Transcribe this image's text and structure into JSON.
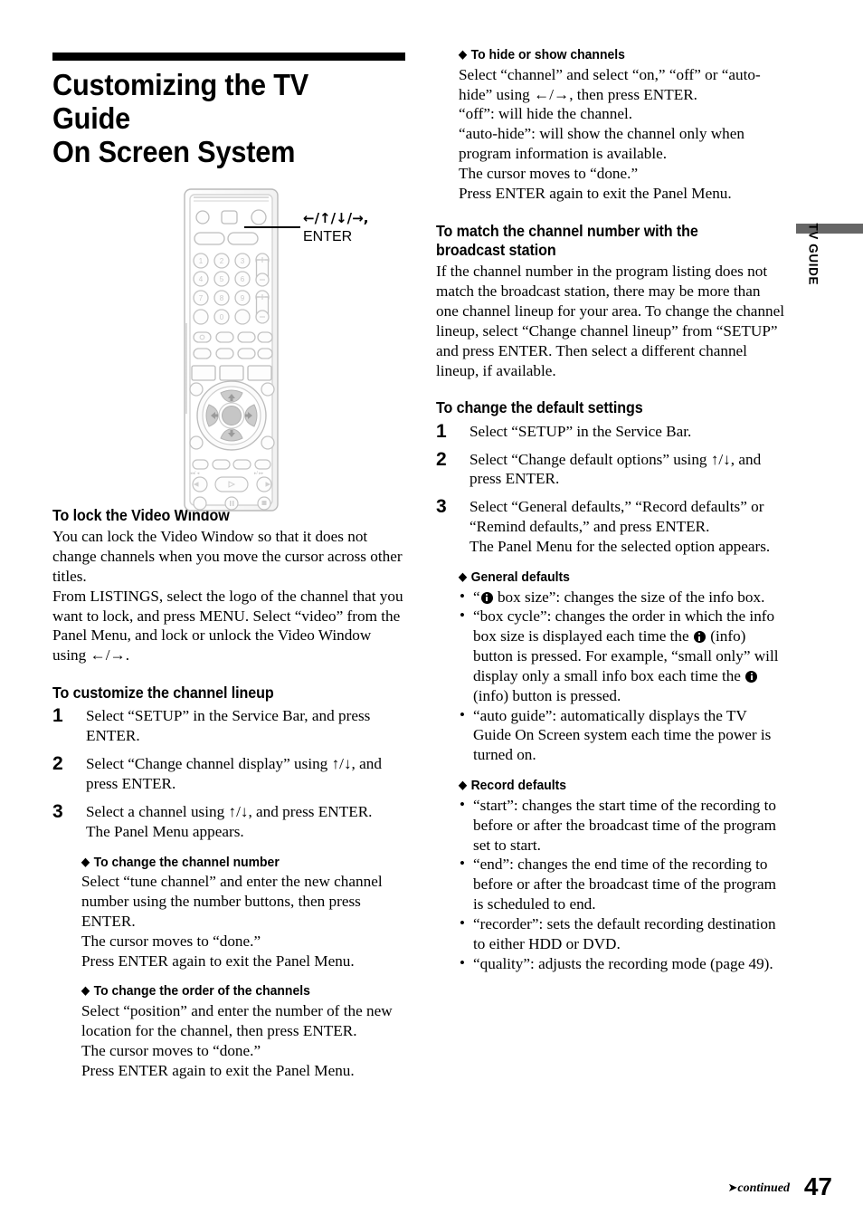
{
  "side_tab": {
    "label": "TV GUIDE",
    "bar_color": "#666666"
  },
  "title": {
    "line1": "Customizing the TV Guide",
    "line2": "On Screen System"
  },
  "figure": {
    "name": "remote-control-illustration",
    "callout_arrows": "←/↑/↓/→,",
    "callout_enter": "ENTER",
    "keys": [
      "1",
      "2",
      "3",
      "4",
      "5",
      "6",
      "7",
      "8",
      "9",
      "0"
    ]
  },
  "left_column": {
    "sections": [
      {
        "heading": "To lock the Video Window",
        "paragraphs": [
          "You can lock the Video Window so that it does not change channels when you move the cursor across other titles.",
          "From LISTINGS, select the logo of the channel that you want to lock, and press MENU. Select “video” from the Panel Menu, and lock or unlock the Video Window using ←/→."
        ]
      },
      {
        "heading": "To customize the channel lineup",
        "steps": [
          {
            "num": "1",
            "text": "Select “SETUP” in the Service Bar, and press ENTER."
          },
          {
            "num": "2",
            "text": "Select “Change channel display” using ↑/↓, and press ENTER."
          },
          {
            "num": "3",
            "text": "Select a channel using ↑/↓, and press ENTER.\nThe Panel Menu appears."
          }
        ],
        "subsections": [
          {
            "heading": "To change the channel number",
            "text": "Select “tune channel” and enter the new channel number using the number buttons, then press ENTER.\nThe cursor moves to “done.”\nPress ENTER again to exit the Panel Menu."
          },
          {
            "heading": "To change the order of the channels",
            "text": "Select “position” and enter the number of the new location for the channel, then press ENTER.\nThe cursor moves to “done.”\nPress ENTER again to exit the Panel Menu."
          }
        ]
      }
    ]
  },
  "right_column": {
    "hide_show": {
      "heading": "To hide or show channels",
      "text": "Select “channel” and select “on,” “off” or “auto-hide” using ←/→, then press ENTER.\n“off”: will hide the channel.\n“auto-hide”: will show the channel only when program information is available.\nThe cursor moves to “done.”\nPress ENTER again to exit the Panel Menu."
    },
    "match_station": {
      "heading": "To match the channel number with the broadcast station",
      "text": "If the channel number in the program listing does not match the broadcast station, there may be more than one channel lineup for your area. To change the channel lineup, select “Change channel lineup” from “SETUP” and press ENTER. Then select a different channel lineup, if available."
    },
    "default_settings": {
      "heading": "To change the default settings",
      "steps": [
        {
          "num": "1",
          "text": "Select “SETUP” in the Service Bar."
        },
        {
          "num": "2",
          "text": "Select “Change default options” using ↑/↓, and press ENTER."
        },
        {
          "num": "3",
          "text": "Select “General defaults,” “Record defaults” or “Remind defaults,” and press ENTER.\nThe Panel Menu for the selected option appears."
        }
      ],
      "general_defaults": {
        "heading": "General defaults",
        "bullets": [
          {
            "pre": "“",
            "icon": "info-icon",
            "post": " box size”: changes the size of the info box."
          },
          {
            "pre": "“box cycle”: changes the order in which the info box size is displayed each time the ",
            "icon": "info-icon",
            "post": " (info) button is pressed. For example, “small only” will display only a small info box each time the ",
            "icon2": "info-icon",
            "post2": " (info) button is pressed."
          },
          {
            "text": "“auto guide”: automatically displays the TV Guide On Screen system each time the power is turned on."
          }
        ]
      },
      "record_defaults": {
        "heading": "Record defaults",
        "bullets": [
          {
            "text": "“start”: changes the start time of the recording to before or after the broadcast time of the program set to start."
          },
          {
            "text": "“end”: changes the end time of the recording to before or after the broadcast time of the program is scheduled to end."
          },
          {
            "text": "“recorder”: sets the default recording destination to either HDD or DVD."
          },
          {
            "text": "“quality”: adjusts the recording mode (page 49)."
          }
        ]
      }
    }
  },
  "footer": {
    "continued": "continued",
    "page_number": "47"
  }
}
